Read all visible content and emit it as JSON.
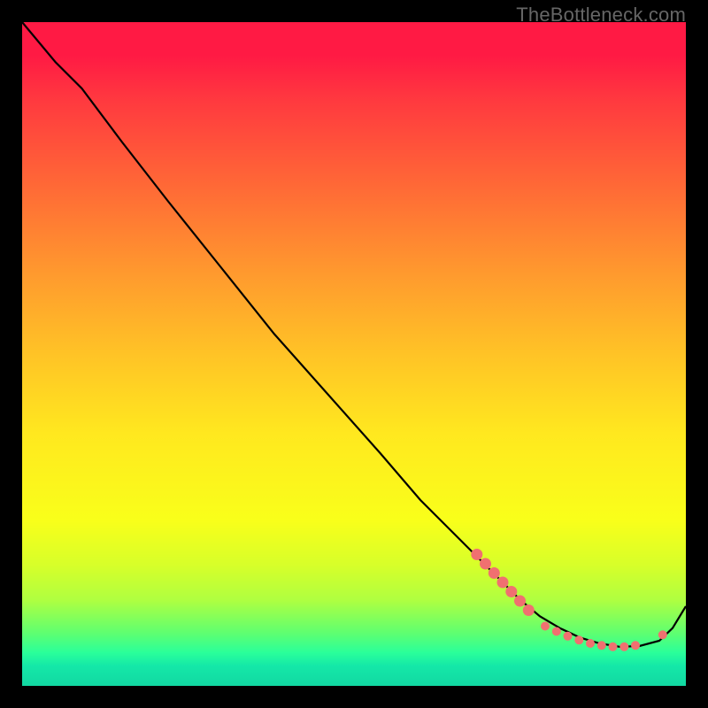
{
  "watermark": "TheBottleneck.com",
  "chart_data": {
    "type": "line",
    "title": "",
    "xlabel": "",
    "ylabel": "",
    "ylim": [
      0,
      100
    ],
    "xlim": [
      0,
      100
    ],
    "grid": false,
    "legend": false,
    "comment": "x/y are percentages of the plot area (0,0 = top-left of the gradient square, 100,100 = bottom-right). Curve starts at top-left, comes down with one inflection, flattens near bottom, and rises slightly at the far right.",
    "series": [
      {
        "name": "bottleneck-curve",
        "x": [
          0,
          5,
          9,
          15,
          22,
          30,
          38,
          46,
          54,
          60,
          65,
          69,
          72,
          75,
          78,
          81,
          84,
          87,
          90,
          93,
          96,
          98,
          100
        ],
        "y": [
          0,
          6,
          10,
          18,
          27,
          37,
          47,
          56,
          65,
          72,
          77,
          81,
          84,
          87,
          89.5,
          91.3,
          92.7,
          93.6,
          94.1,
          94.0,
          93.2,
          91.3,
          88.0
        ]
      }
    ],
    "markers": {
      "comment": "clustered salmon points near curve minimum and on rising tail",
      "points": [
        {
          "x": 68.5,
          "y": 80.2,
          "r": 6.5
        },
        {
          "x": 69.8,
          "y": 81.6,
          "r": 6.5
        },
        {
          "x": 71.1,
          "y": 83.0,
          "r": 6.5
        },
        {
          "x": 72.4,
          "y": 84.4,
          "r": 6.5
        },
        {
          "x": 73.7,
          "y": 85.8,
          "r": 6.5
        },
        {
          "x": 75.0,
          "y": 87.2,
          "r": 6.5
        },
        {
          "x": 76.3,
          "y": 88.6,
          "r": 6.5
        },
        {
          "x": 78.8,
          "y": 91.0,
          "r": 5.0
        },
        {
          "x": 80.5,
          "y": 91.8,
          "r": 5.0
        },
        {
          "x": 82.2,
          "y": 92.5,
          "r": 5.0
        },
        {
          "x": 83.9,
          "y": 93.1,
          "r": 5.0
        },
        {
          "x": 85.6,
          "y": 93.6,
          "r": 5.0
        },
        {
          "x": 87.3,
          "y": 93.9,
          "r": 5.0
        },
        {
          "x": 89.0,
          "y": 94.1,
          "r": 5.0
        },
        {
          "x": 90.7,
          "y": 94.1,
          "r": 5.0
        },
        {
          "x": 92.4,
          "y": 93.9,
          "r": 5.0
        },
        {
          "x": 96.5,
          "y": 92.3,
          "r": 5.0
        }
      ],
      "color": "#f07070"
    },
    "curve_color": "#000000"
  }
}
